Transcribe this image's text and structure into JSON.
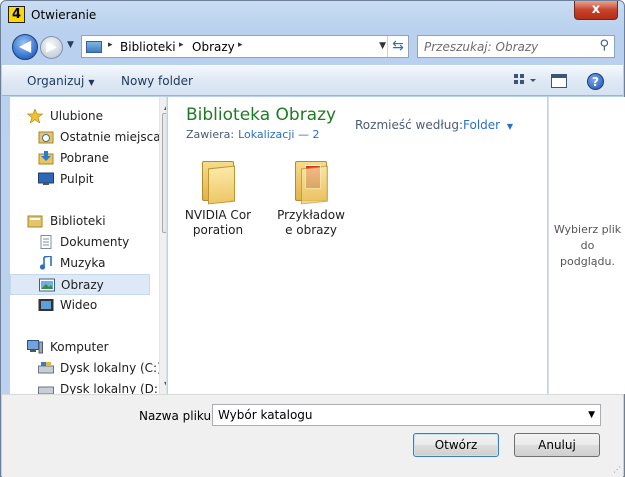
{
  "window": {
    "title": "Otwieranie",
    "close_glyph": "x",
    "app_icon_glyph": "4"
  },
  "address_bar": {
    "segments": [
      "Biblioteki",
      "Obrazy"
    ],
    "separator": "▸"
  },
  "search": {
    "placeholder": "Przeszukaj: Obrazy"
  },
  "toolbar": {
    "organize_label": "Organizuj",
    "new_folder_label": "Nowy folder"
  },
  "nav_pane": {
    "favorites": {
      "label": "Ulubione",
      "items": [
        "Ostatnie miejsca",
        "Pobrane",
        "Pulpit"
      ]
    },
    "libraries": {
      "label": "Biblioteki",
      "items": [
        "Dokumenty",
        "Muzyka",
        "Obrazy",
        "Wideo"
      ],
      "selected": "Obrazy"
    },
    "computer": {
      "label": "Komputer",
      "items": [
        "Dysk lokalny (C:)",
        "Dysk lokalny (D:)"
      ]
    }
  },
  "content": {
    "title": "Biblioteka Obrazy",
    "contains_label": "Zawiera:",
    "contains_link": "Lokalizacji — 2",
    "arrange_label": "Rozmieść według:",
    "arrange_value": "Folder",
    "folders": [
      {
        "label": "NVIDIA Corporation"
      },
      {
        "label": "Przykładowe obrazy"
      }
    ]
  },
  "preview": {
    "text_lines": [
      "Wybierz plik",
      "do",
      "podglądu."
    ]
  },
  "bottom": {
    "filename_label": "Nazwa pliku:",
    "filename_value": "Wybór katalogu",
    "open_button": "Otwórz",
    "cancel_button": "Anuluj"
  },
  "colors": {
    "title_green": "#1e7b23",
    "link_blue": "#2a6fc4",
    "selection": "#dde9f6"
  }
}
